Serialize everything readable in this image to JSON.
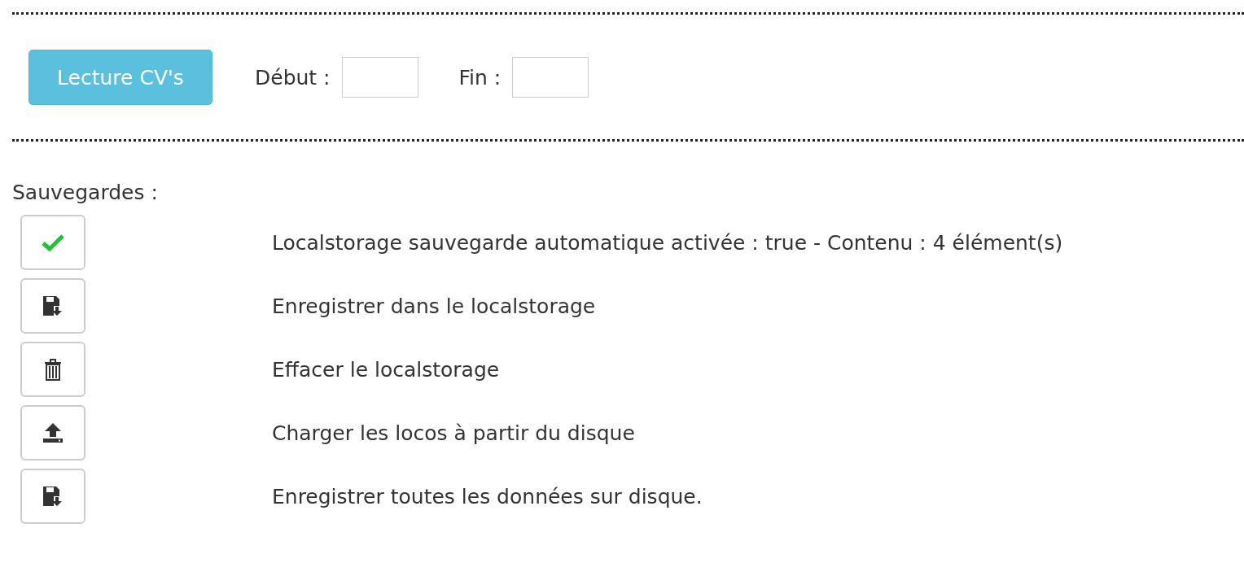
{
  "read_button": {
    "label": "Lecture CV's"
  },
  "start_field": {
    "label": "Début :"
  },
  "end_field": {
    "label": "Fin :"
  },
  "saves": {
    "title": "Sauvegardes :",
    "rows": [
      {
        "kind": "check",
        "text": "Localstorage sauvegarde automatique activée : true - Contenu : 4 élément(s)"
      },
      {
        "kind": "save",
        "text": "Enregistrer dans le localstorage"
      },
      {
        "kind": "trash",
        "text": "Effacer le localstorage"
      },
      {
        "kind": "upload",
        "text": "Charger les locos à partir du disque"
      },
      {
        "kind": "save",
        "text": "Enregistrer toutes les données sur disque."
      }
    ]
  }
}
